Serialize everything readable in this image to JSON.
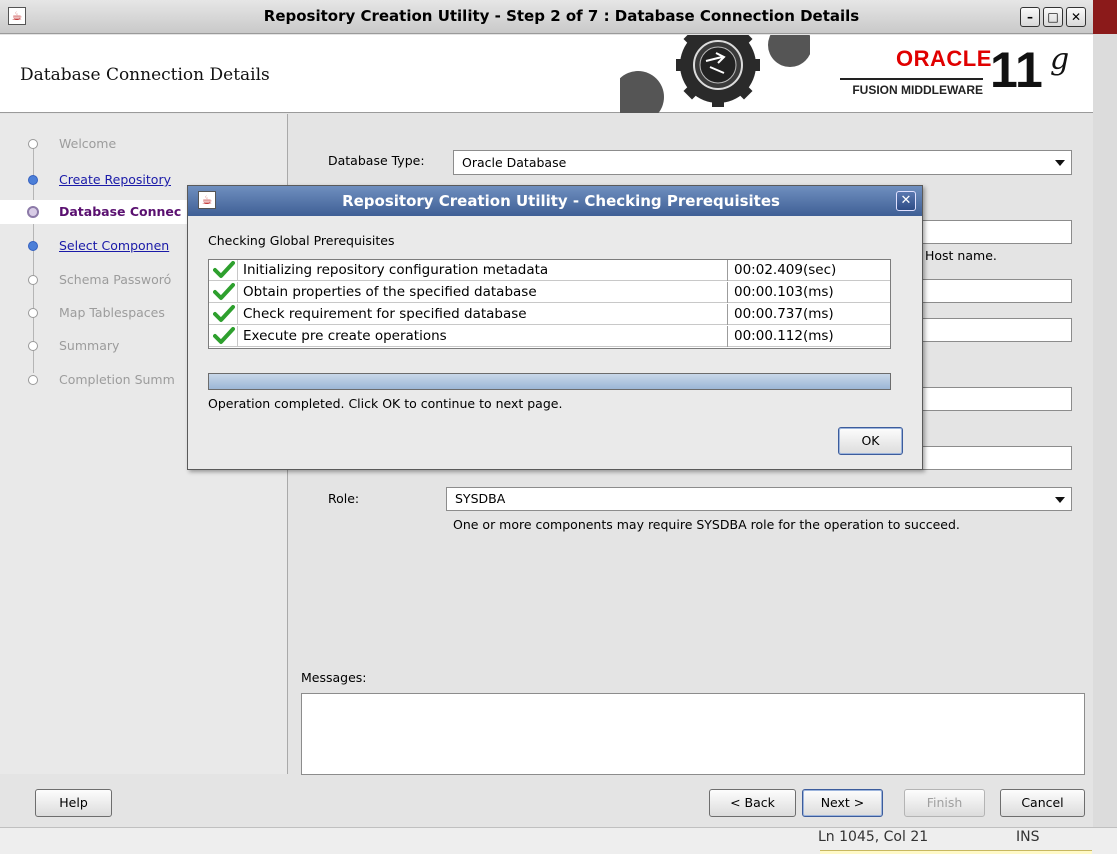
{
  "window": {
    "title": "Repository Creation Utility - Step 2 of 7 : Database Connection Details",
    "minimize_glyph": "–",
    "maximize_glyph": "□",
    "close_glyph": "✕"
  },
  "header": {
    "title": "Database Connection Details",
    "logo_word": "ORACLE",
    "logo_product": "FUSION MIDDLEWARE",
    "logo_version": "11",
    "logo_suffix": "g"
  },
  "nav": {
    "items": [
      {
        "label": "Welcome",
        "state": "disabled"
      },
      {
        "label": "Create Repository",
        "state": "link"
      },
      {
        "label": "Database Connec",
        "state": "current"
      },
      {
        "label": "Select Componen",
        "state": "link"
      },
      {
        "label": "Schema Passworó",
        "state": "disabled"
      },
      {
        "label": "Map Tablespaces",
        "state": "disabled"
      },
      {
        "label": "Summary",
        "state": "disabled"
      },
      {
        "label": "Completion Summ",
        "state": "disabled"
      }
    ]
  },
  "form": {
    "db_type_label": "Database Type:",
    "db_type_value": "Oracle Database",
    "host_hint": "Host name.",
    "role_label": "Role:",
    "role_value": "SYSDBA",
    "role_hint": "One or more components may require SYSDBA role for the operation to succeed.",
    "messages_label": "Messages:"
  },
  "buttons": {
    "help": "Help",
    "back": "< Back",
    "next": "Next >",
    "finish": "Finish",
    "cancel": "Cancel"
  },
  "status_bar": {
    "position": "Ln 1045, Col 21",
    "mode": "INS"
  },
  "dialog": {
    "title": "Repository Creation Utility - Checking Prerequisites",
    "close_glyph": "✕",
    "section_label": "Checking Global Prerequisites",
    "rows": [
      {
        "task": "Initializing repository configuration metadata",
        "time": "00:02.409(sec)",
        "status": "passed"
      },
      {
        "task": "Obtain properties of the specified database",
        "time": "00:00.103(ms)",
        "status": "passed"
      },
      {
        "task": "Check requirement for specified database",
        "time": "00:00.737(ms)",
        "status": "passed"
      },
      {
        "task": "Execute pre create operations",
        "time": "00:00.112(ms)",
        "status": "passed"
      }
    ],
    "progress_percent": 100,
    "status_text": "Operation completed. Click OK to continue to next page.",
    "ok_label": "OK"
  },
  "colors": {
    "accent_link": "#1a1aa8",
    "current_step": "#5a1070",
    "dialog_title": "#3f5f95",
    "oracle_red": "#e00000",
    "check_green": "#2ea02e"
  }
}
